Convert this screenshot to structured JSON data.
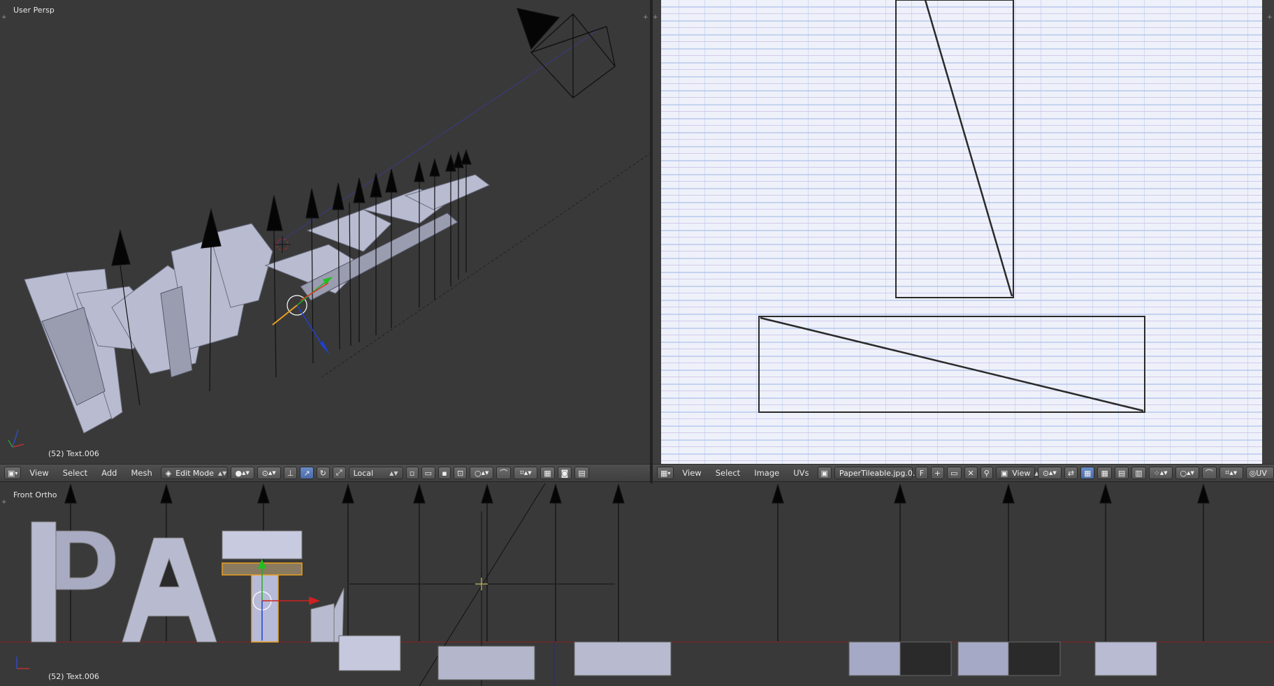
{
  "viewport_top": {
    "view_name": "User Persp",
    "object_info": "(52) Text.006"
  },
  "viewport_bottom": {
    "view_name": "Front Ortho",
    "object_info": "(52) Text.006"
  },
  "header_3d": {
    "menus": [
      "View",
      "Select",
      "Add",
      "Mesh"
    ],
    "mode": "Edit Mode",
    "orientation": "Local"
  },
  "header_uv": {
    "menus": [
      "View",
      "Select",
      "Image",
      "UVs"
    ],
    "image_name": "PaperTileable.jpg.0...",
    "fake_user": "F",
    "view_dropdown": "View",
    "uv_label": "UV"
  },
  "colors": {
    "viewport_bg": "#393939",
    "header_bg": "#4a4a4a",
    "grid_paper": "#e8ecf6",
    "accent_blue": "#5a7cc0",
    "selection_orange": "#e8a020"
  }
}
